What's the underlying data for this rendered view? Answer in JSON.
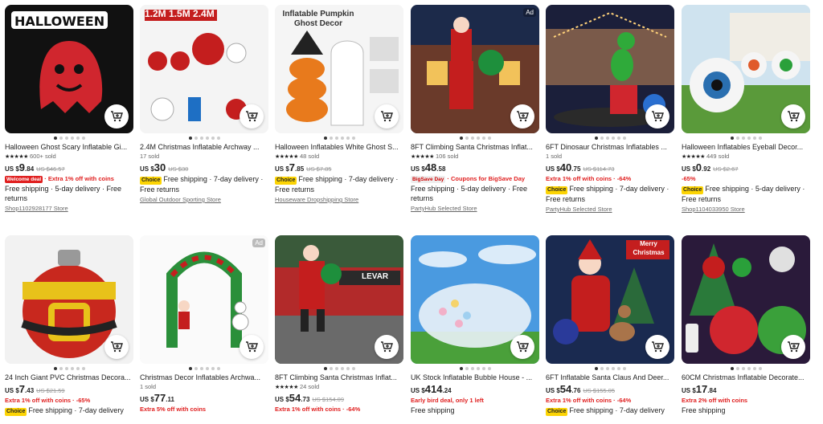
{
  "products": [
    {
      "title": "Halloween Ghost Scary Inflatable Gi...",
      "stars": "★★★★★",
      "sold": "600+ sold",
      "cur": "US $",
      "price_int": "9",
      "price_dec": ".84",
      "orig": "US $46.57",
      "promo_tag": "Welcome deal",
      "promo": "· Extra 1% off with coins",
      "choice": "",
      "shipping": "Free shipping · 5-day delivery · Free returns",
      "store": "Shop1102928177 Store",
      "ad": "",
      "image_caption": "HALLOWEEN"
    },
    {
      "title": "2.4M Christmas Inflatable Archway ...",
      "stars": "",
      "sold": "17 sold",
      "cur": "US $",
      "price_int": "30",
      "price_dec": "",
      "orig": "US $30",
      "promo_tag": "",
      "promo": "",
      "choice": "Choice",
      "shipping": "Free shipping · 7-day delivery · Free returns",
      "store": "Global Outdoor Sporting Store",
      "ad": "",
      "image_caption": "1.2M 1.5M 2.4M"
    },
    {
      "title": "Halloween Inflatables White Ghost S...",
      "stars": "★★★★★",
      "sold": "48 sold",
      "cur": "US $",
      "price_int": "7",
      "price_dec": ".85",
      "orig": "US $7.85",
      "promo_tag": "",
      "promo": "",
      "choice": "Choice",
      "shipping": "Free shipping · 7-day delivery · Free returns",
      "store": "Houseware Dropshipping Store",
      "ad": "",
      "image_caption": "Inflatable Pumpkin Ghost Decor"
    },
    {
      "title": "8FT Climbing Santa Christmas Inflat...",
      "stars": "★★★★★",
      "sold": "106 sold",
      "cur": "US $",
      "price_int": "48",
      "price_dec": ".58",
      "orig": "",
      "promo_tag": "BigSave Day",
      "promo": "· Coupons for BigSave Day",
      "choice": "",
      "shipping": "Free shipping · 5-day delivery · Free returns",
      "store": "PartyHub Selected Store",
      "ad": "Ad",
      "image_caption": ""
    },
    {
      "title": "6FT Dinosaur Christmas Inflatables ...",
      "stars": "",
      "sold": "1 sold",
      "cur": "US $",
      "price_int": "40",
      "price_dec": ".75",
      "orig": "US $114.73",
      "promo_tag": "",
      "promo": "Extra 1% off with coins · -64%",
      "choice": "Choice",
      "shipping": "Free shipping · 7-day delivery · Free returns",
      "store": "PartyHub Selected Store",
      "ad": "",
      "image_caption": ""
    },
    {
      "title": "Halloween Inflatables Eyeball Decor...",
      "stars": "★★★★★",
      "sold": "449 sold",
      "cur": "US $",
      "price_int": "0",
      "price_dec": ".92",
      "orig": "US $2.67",
      "promo_tag": "",
      "promo": "-65%",
      "choice": "Choice",
      "shipping": "Free shipping · 5-day delivery · Free returns",
      "store": "Shop1104033950 Store",
      "ad": "",
      "image_caption": ""
    },
    {
      "title": "24 Inch Giant PVC Christmas Decora...",
      "stars": "",
      "sold": "",
      "cur": "US $",
      "price_int": "7",
      "price_dec": ".43",
      "orig": "US $21.59",
      "promo_tag": "",
      "promo": "Extra 1% off with coins · -65%",
      "choice": "Choice",
      "shipping": "Free shipping · 7-day delivery",
      "store": "",
      "ad": "",
      "image_caption": ""
    },
    {
      "title": "Christmas Decor Inflatables Archwa...",
      "stars": "",
      "sold": "1 sold",
      "cur": "US $",
      "price_int": "77",
      "price_dec": ".11",
      "orig": "",
      "promo_tag": "",
      "promo": "Extra 5% off with coins",
      "choice": "",
      "shipping": "",
      "store": "",
      "ad": "Ad",
      "image_caption": ""
    },
    {
      "title": "8FT Climbing Santa Christmas Inflat...",
      "stars": "★★★★★",
      "sold": "24 sold",
      "cur": "US $",
      "price_int": "54",
      "price_dec": ".73",
      "orig": "US $154.09",
      "promo_tag": "",
      "promo": "Extra 1% off with coins · -64%",
      "choice": "",
      "shipping": "",
      "store": "",
      "ad": "",
      "image_caption": "LEVAR"
    },
    {
      "title": "UK Stock Inflatable Bubble House - ...",
      "stars": "",
      "sold": "",
      "cur": "US $",
      "price_int": "414",
      "price_dec": ".24",
      "orig": "",
      "promo_tag": "",
      "promo": "Early bird deal, only 1 left",
      "choice": "",
      "shipping": "Free shipping",
      "store": "",
      "ad": "",
      "image_caption": ""
    },
    {
      "title": "6FT Inflatable Santa Claus And Deer...",
      "stars": "",
      "sold": "",
      "cur": "US $",
      "price_int": "54",
      "price_dec": ".76",
      "orig": "US $155.05",
      "promo_tag": "",
      "promo": "Extra 1% off with coins · -64%",
      "choice": "Choice",
      "shipping": "Free shipping · 7-day delivery",
      "store": "",
      "ad": "",
      "image_caption": "Merry Christmas"
    },
    {
      "title": "60CM Christmas Inflatable Decorate...",
      "stars": "",
      "sold": "",
      "cur": "US $",
      "price_int": "17",
      "price_dec": ".84",
      "orig": "",
      "promo_tag": "",
      "promo": "Extra 2% off with coins",
      "choice": "",
      "shipping": "Free shipping",
      "store": "",
      "ad": "",
      "image_caption": ""
    }
  ],
  "colors": {
    "red": "#e02020",
    "choice_yellow": "#fcd404"
  }
}
